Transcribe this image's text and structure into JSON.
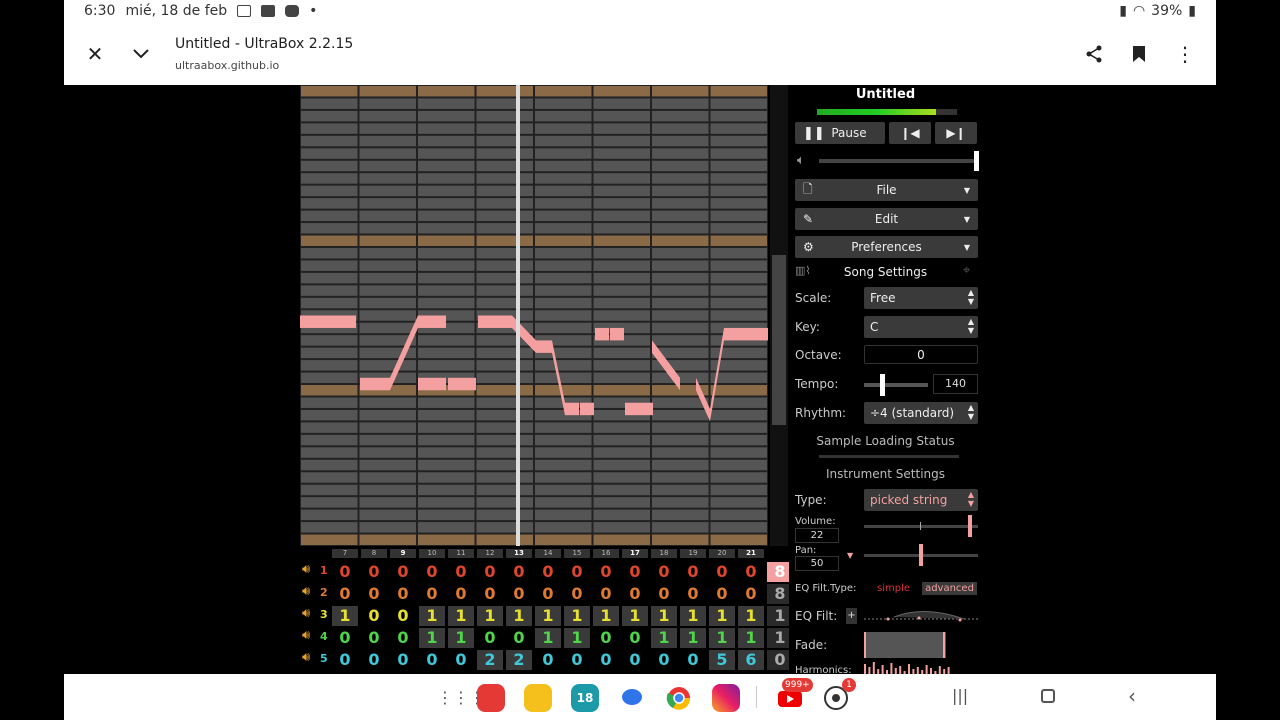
{
  "status_bar": {
    "time": "6:30",
    "date": "mié, 18 de feb",
    "battery": "39%"
  },
  "browser": {
    "title": "Untitled - UltraBox 2.2.15",
    "url": "ultraabox.github.io"
  },
  "song": {
    "title": "Untitled",
    "pause_label": "Pause"
  },
  "menus": {
    "file": "File",
    "edit": "Edit",
    "preferences": "Preferences"
  },
  "song_settings": {
    "heading": "Song Settings",
    "scale_label": "Scale:",
    "scale_value": "Free",
    "key_label": "Key:",
    "key_value": "C",
    "octave_label": "Octave:",
    "octave_value": "0",
    "tempo_label": "Tempo:",
    "tempo_value": "140",
    "rhythm_label": "Rhythm:",
    "rhythm_value": "÷4 (standard)"
  },
  "sample_status": "Sample Loading Status",
  "instrument_settings": {
    "heading": "Instrument Settings",
    "type_label": "Type:",
    "type_value": "picked string",
    "volume_label": "Volume:",
    "volume_value": "22",
    "pan_label": "Pan:",
    "pan_value": "50",
    "eq_type_label": "EQ Filt.Type:",
    "eq_simple": "simple",
    "eq_advanced": "advanced",
    "eq_filt_label": "EQ Filt:",
    "fade_label": "Fade:",
    "harmonics_label": "Harmonics:"
  },
  "bar_numbers": [
    "7",
    "8",
    "9",
    "10",
    "11",
    "12",
    "13",
    "14",
    "15",
    "16",
    "17",
    "18",
    "19",
    "20",
    "21"
  ],
  "channels": [
    {
      "num": "1",
      "color": "#e0462e",
      "cells": [
        "0",
        "0",
        "0",
        "0",
        "0",
        "0",
        "0",
        "0",
        "0",
        "0",
        "0",
        "0",
        "0",
        "0",
        "0",
        "8"
      ]
    },
    {
      "num": "2",
      "color": "#e07a2e",
      "cells": [
        "0",
        "0",
        "0",
        "0",
        "0",
        "0",
        "0",
        "0",
        "0",
        "0",
        "0",
        "0",
        "0",
        "0",
        "0",
        "8"
      ]
    },
    {
      "num": "3",
      "color": "#e8e030",
      "cells": [
        "1",
        "0",
        "0",
        "1",
        "1",
        "1",
        "1",
        "1",
        "1",
        "1",
        "1",
        "1",
        "1",
        "1",
        "1",
        "1"
      ]
    },
    {
      "num": "4",
      "color": "#4fd44a",
      "cells": [
        "0",
        "0",
        "0",
        "1",
        "1",
        "0",
        "0",
        "1",
        "1",
        "0",
        "0",
        "1",
        "1",
        "1",
        "1",
        "1"
      ]
    },
    {
      "num": "5",
      "color": "#3fc8d8",
      "cells": [
        "0",
        "0",
        "0",
        "0",
        "0",
        "2",
        "2",
        "0",
        "0",
        "0",
        "0",
        "0",
        "0",
        "5",
        "6",
        "0"
      ]
    }
  ],
  "nav": {
    "youtube_badge": "999+",
    "soccer_badge": "1",
    "calendar_day": "18"
  },
  "colors": {
    "note": "#f5a0a0",
    "bar_accent": "#8b6a48",
    "grid_row": "#555555"
  }
}
